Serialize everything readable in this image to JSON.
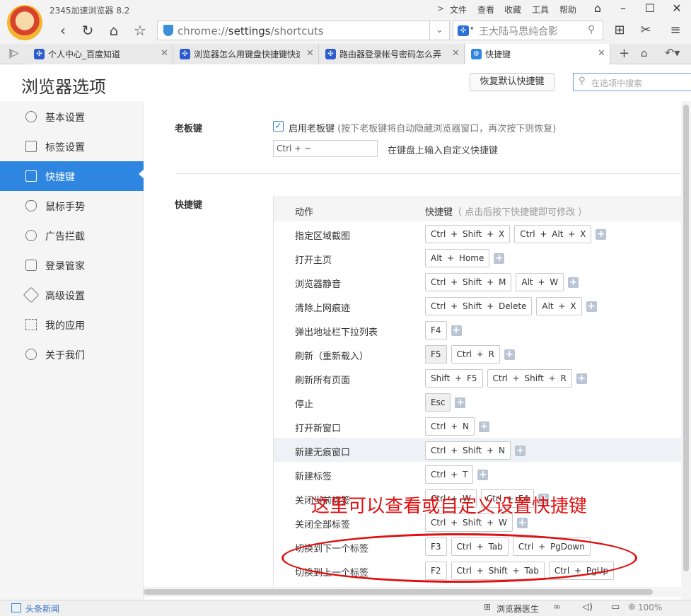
{
  "window": {
    "app_title": "2345加速浏览器 8.2",
    "menus": [
      "文件",
      "查看",
      "收藏",
      "工具",
      "帮助"
    ]
  },
  "toolbar": {
    "address_prefix": "chrome://",
    "address_bold": "settings",
    "address_suffix": "/shortcuts",
    "search_text": "王大陆马思纯合影"
  },
  "tabs": [
    {
      "label": "个人中心_百度知道",
      "active": false
    },
    {
      "label": "浏览器怎么用键盘快捷键快速",
      "active": false
    },
    {
      "label": "路由器登录帐号密码怎么弄",
      "active": false
    },
    {
      "label": "快捷键",
      "active": true
    }
  ],
  "header": {
    "title": "浏览器选项",
    "restore_label": "恢复默认快捷键",
    "search_placeholder": "在选项中搜索"
  },
  "sidebar": {
    "items": [
      {
        "label": "基本设置",
        "icon": "gear-icon"
      },
      {
        "label": "标签设置",
        "icon": "tabs-icon"
      },
      {
        "label": "快捷键",
        "icon": "keyboard-icon",
        "active": true
      },
      {
        "label": "鼠标手势",
        "icon": "mouse-icon"
      },
      {
        "label": "广告拦截",
        "icon": "block-icon"
      },
      {
        "label": "登录管家",
        "icon": "lock-icon"
      },
      {
        "label": "高级设置",
        "icon": "wrench-icon"
      },
      {
        "label": "我的应用",
        "icon": "apps-icon"
      },
      {
        "label": "关于我们",
        "icon": "info-icon"
      }
    ]
  },
  "boss_key": {
    "section_label": "老板键",
    "enabled": true,
    "enable_label": "启用老板键",
    "enable_note": "(按下老板键将自动隐藏浏览器窗口，再次按下则恢复)",
    "value": "Ctrl + ~",
    "hint": "在键盘上输入自定义快捷键"
  },
  "shortcuts": {
    "section_label": "快捷键",
    "col_action": "动作",
    "col_keys": "快捷键",
    "col_keys_note": "（ 点击后按下快捷键即可修改 ）",
    "rows": [
      {
        "action": "指定区域截图",
        "keys": [
          "Ctrl + Shift + X",
          "Ctrl + Alt + X"
        ]
      },
      {
        "action": "打开主页",
        "keys": [
          "Alt + Home"
        ]
      },
      {
        "action": "浏览器静音",
        "keys": [
          "Ctrl + Shift + M",
          "Alt + W"
        ]
      },
      {
        "action": "清除上网痕迹",
        "keys": [
          "Ctrl + Shift + Delete",
          "Alt + X"
        ]
      },
      {
        "action": "弹出地址栏下拉列表",
        "keys": [
          "F4"
        ]
      },
      {
        "action": "刷新（重新载入）",
        "keys": [
          "F5",
          "Ctrl + R"
        ]
      },
      {
        "action": "刷新所有页面",
        "keys": [
          "Shift + F5",
          "Ctrl + Shift + R"
        ]
      },
      {
        "action": "停止",
        "keys": [
          "Esc"
        ]
      },
      {
        "action": "打开新窗口",
        "keys": [
          "Ctrl + N"
        ]
      },
      {
        "action": "新建无痕窗口",
        "keys": [
          "Ctrl + Shift + N"
        ],
        "highlight": true
      },
      {
        "action": "新建标签",
        "keys": [
          "Ctrl + T"
        ]
      },
      {
        "action": "关闭当前标签",
        "keys": [
          "Ctrl + W",
          "Ctrl + F4"
        ]
      },
      {
        "action": "关闭全部标签",
        "keys": [
          "Ctrl + Shift + W"
        ]
      },
      {
        "action": "切换到下一个标签",
        "keys": [
          "F3",
          "Ctrl + Tab",
          "Ctrl + PgDown"
        ]
      },
      {
        "action": "切换到上一个标签",
        "keys": [
          "F2",
          "Ctrl + Shift + Tab",
          "Ctrl + PgUp"
        ]
      }
    ]
  },
  "annotation": "这里可以查看或自定义设置快捷键",
  "statusbar": {
    "news_label": "头条新闻",
    "doctor_label": "浏览器医生",
    "zoom": "100%"
  },
  "colors": {
    "accent": "#2f86e0",
    "annotation": "#e01010"
  }
}
